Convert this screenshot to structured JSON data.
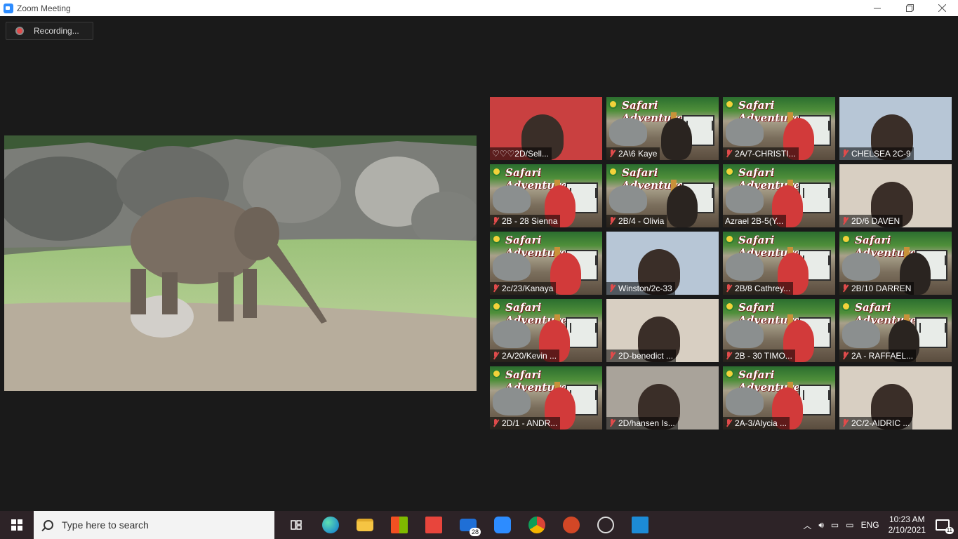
{
  "window": {
    "title": "Zoom Meeting",
    "minimize_icon": "minimize-icon",
    "restore_icon": "restore-icon",
    "close_icon": "close-icon"
  },
  "recording": {
    "label": "Recording...",
    "color": "#e04b4b"
  },
  "participants": [
    {
      "name": "2D/Sell...",
      "prefix": "♡♡♡",
      "muted": false,
      "feed": "camera"
    },
    {
      "name": "2A\\6 Kaye",
      "muted": true,
      "feed": "banner"
    },
    {
      "name": "2A/7-CHRISTI...",
      "muted": true,
      "feed": "banner"
    },
    {
      "name": "CHELSEA 2C-9",
      "muted": true,
      "feed": "camera"
    },
    {
      "name": "2B - 28 Sienna",
      "muted": true,
      "feed": "banner"
    },
    {
      "name": "2B/4 - Olivia",
      "muted": true,
      "feed": "banner"
    },
    {
      "name": "Azrael 2B-5(Y...",
      "muted": false,
      "feed": "banner"
    },
    {
      "name": "2D/6 DAVEN",
      "muted": true,
      "feed": "camera"
    },
    {
      "name": "2c/23/Kanaya",
      "muted": true,
      "feed": "banner"
    },
    {
      "name": "Winston/2c-33",
      "muted": true,
      "feed": "camera"
    },
    {
      "name": "2B/8 Cathrey...",
      "muted": true,
      "feed": "banner"
    },
    {
      "name": "2B/10 DARREN",
      "muted": true,
      "feed": "banner"
    },
    {
      "name": "2A/20/Kevin ...",
      "muted": true,
      "feed": "banner"
    },
    {
      "name": "2D-benedict ...",
      "muted": true,
      "feed": "camera"
    },
    {
      "name": "2B - 30 TIMO...",
      "muted": true,
      "feed": "banner"
    },
    {
      "name": "2A - RAFFAEL...",
      "muted": true,
      "feed": "banner"
    },
    {
      "name": "2D/1 - ANDR...",
      "muted": true,
      "feed": "banner"
    },
    {
      "name": "2D/hansen Is...",
      "muted": true,
      "feed": "camera"
    },
    {
      "name": "2A-3/Alycia ...",
      "muted": true,
      "feed": "banner"
    },
    {
      "name": "2C/2-AIDRIC ...",
      "muted": true,
      "feed": "camera"
    }
  ],
  "banner_text": "Safari Adventure",
  "taskbar": {
    "search_placeholder": "Type here to search",
    "mail_badge": "28",
    "language": "ENG",
    "time": "10:23 AM",
    "date": "2/10/2021",
    "notification_count": "11",
    "icons": [
      "task-view-icon",
      "edge-icon",
      "file-explorer-icon",
      "store-icon",
      "gift-icon",
      "mail-icon",
      "zoom-icon",
      "chrome-icon",
      "powerpoint-icon",
      "obs-icon",
      "app-icon"
    ]
  }
}
